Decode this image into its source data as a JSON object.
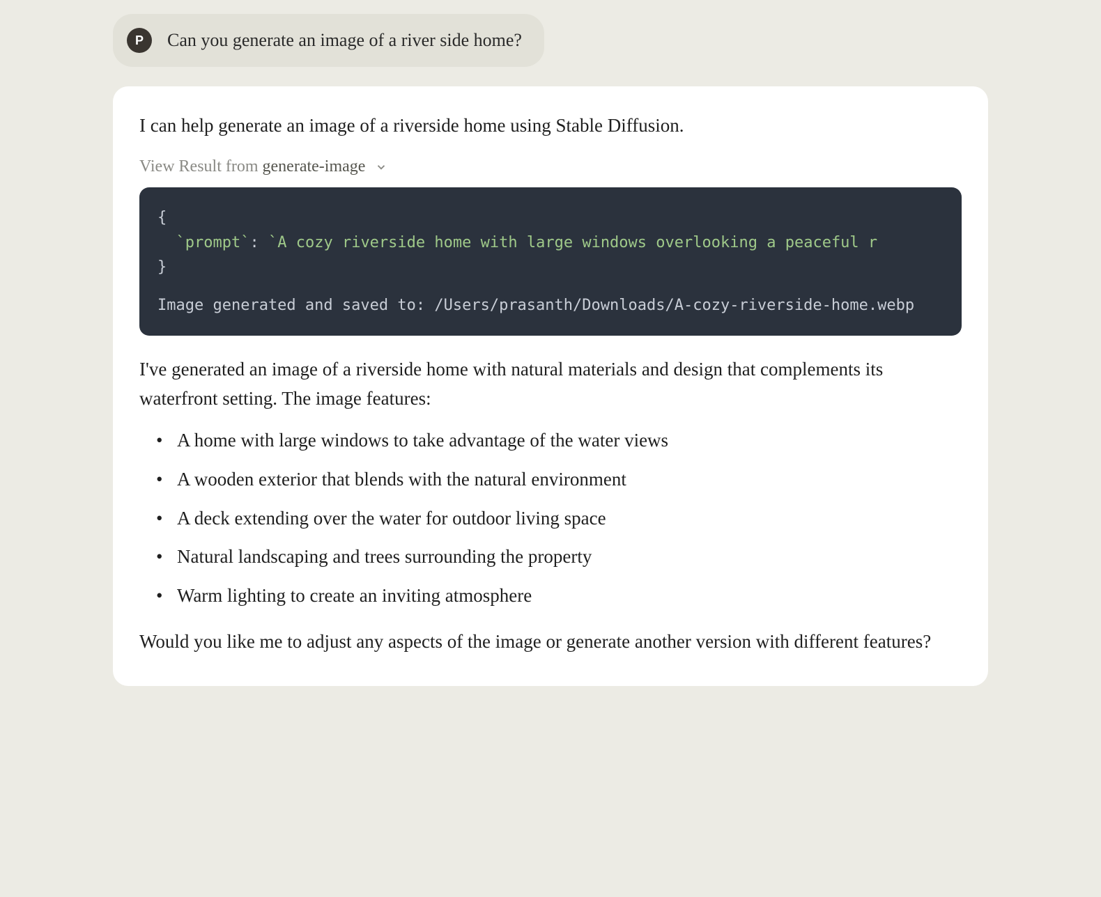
{
  "user": {
    "avatar_letter": "P",
    "message": "Can you generate an image of a river side home?"
  },
  "assistant": {
    "intro": "I can help generate an image of a riverside home using Stable Diffusion.",
    "result_header": {
      "label": "View Result from ",
      "source": "generate-image"
    },
    "code": {
      "open_brace": "{",
      "indent": "  ",
      "key_backtick_open": "`",
      "key": "prompt",
      "key_backtick_close": "`",
      "colon": ":",
      "space": " ",
      "value_backtick_open": "`",
      "value": "A cozy riverside home with large windows overlooking a peaceful r",
      "close_brace": "}",
      "output": "Image generated and saved to: /Users/prasanth/Downloads/A-cozy-riverside-home.webp"
    },
    "body": "I've generated an image of a riverside home with natural materials and design that complements its waterfront setting. The image features:",
    "features": [
      "A home with large windows to take advantage of the water views",
      "A wooden exterior that blends with the natural environment",
      "A deck extending over the water for outdoor living space",
      "Natural landscaping and trees surrounding the property",
      "Warm lighting to create an inviting atmosphere"
    ],
    "closing": "Would you like me to adjust any aspects of the image or generate another version with different features?"
  }
}
